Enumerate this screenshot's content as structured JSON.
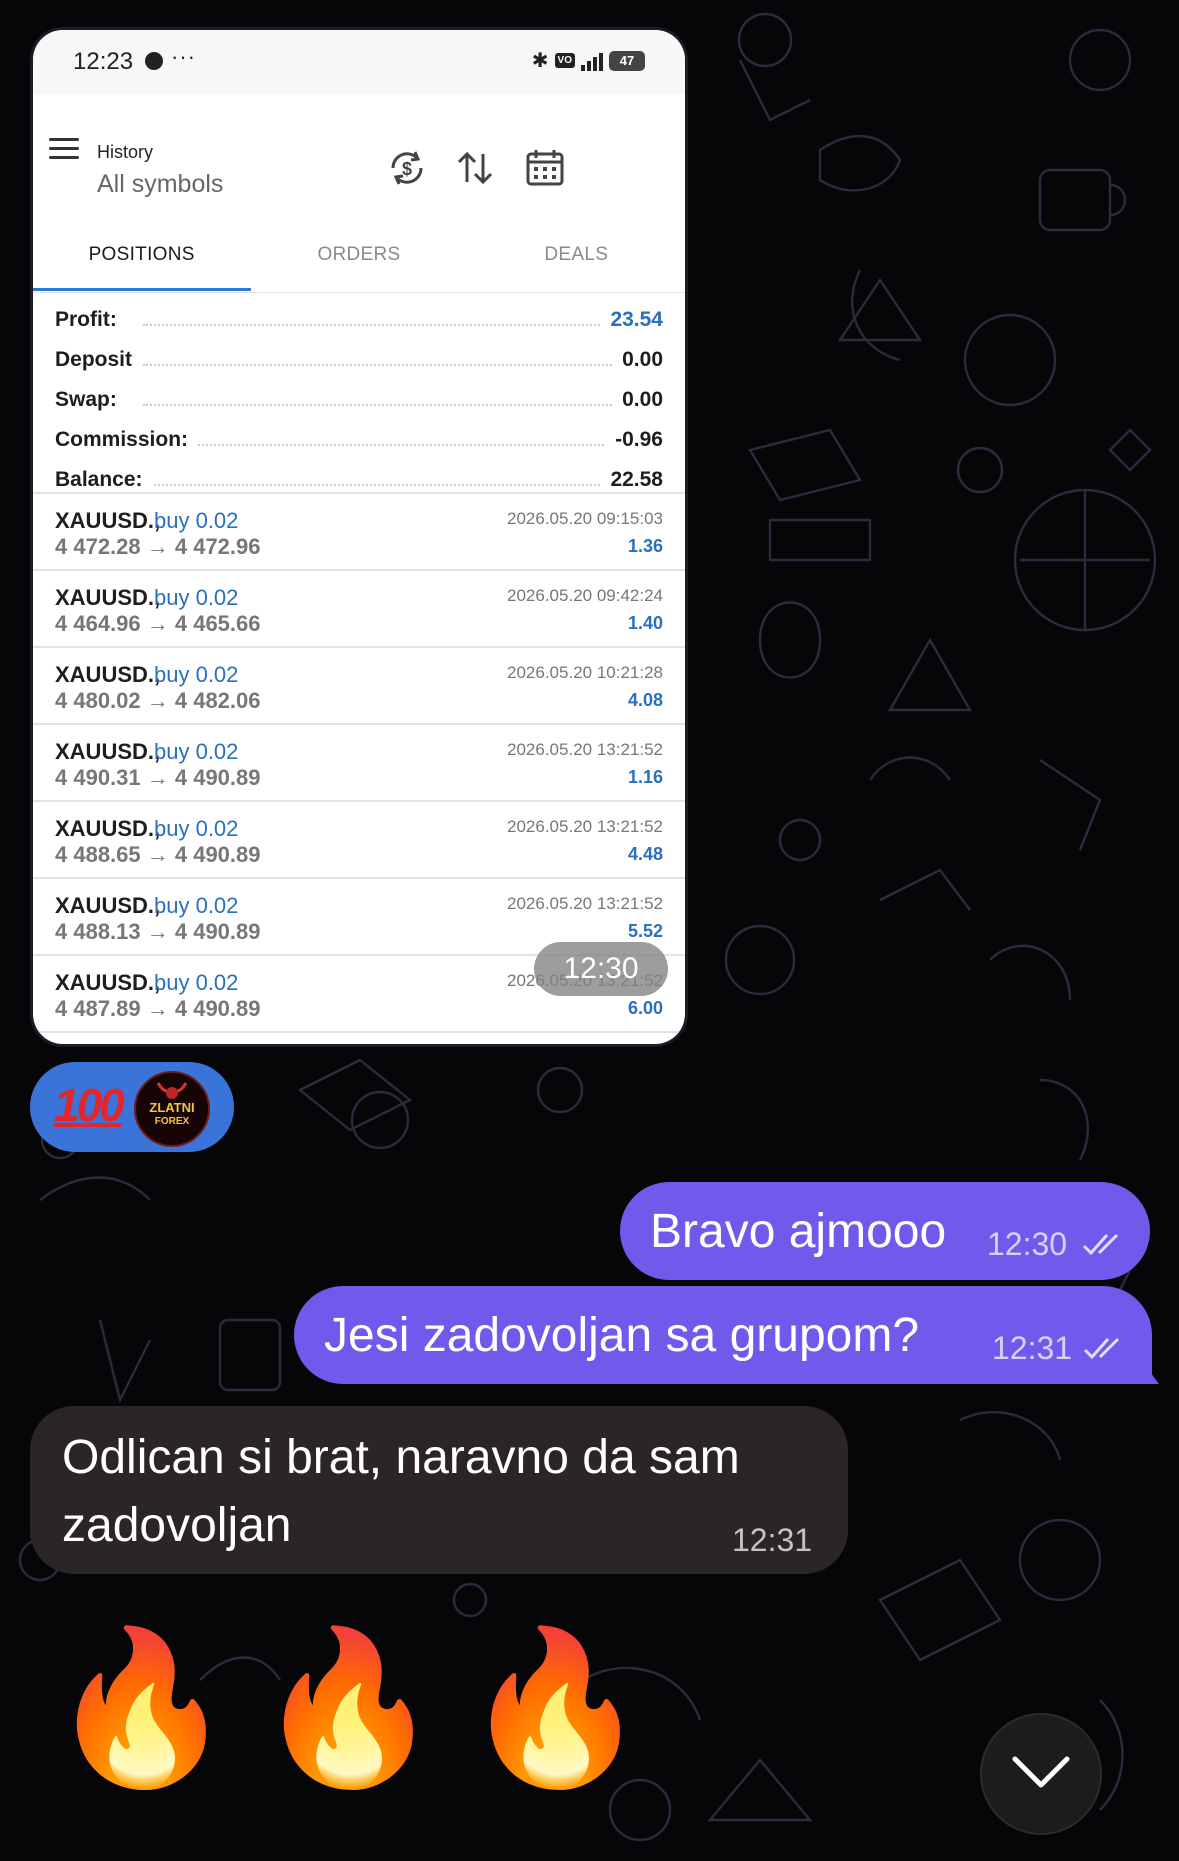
{
  "status_bar": {
    "time": "12:23",
    "more": "···",
    "network": "4G+",
    "battery": "47"
  },
  "history": {
    "title": "History",
    "subtitle": "All symbols"
  },
  "tabs": [
    "POSITIONS",
    "ORDERS",
    "DEALS"
  ],
  "summary": [
    {
      "label": "Profit:",
      "value": "23.54",
      "highlight": true
    },
    {
      "label": "Deposit",
      "value": "0.00",
      "highlight": false
    },
    {
      "label": "Swap:",
      "value": "0.00",
      "highlight": false
    },
    {
      "label": "Commission:",
      "value": "-0.96",
      "highlight": false
    },
    {
      "label": "Balance:",
      "value": "22.58",
      "highlight": false
    }
  ],
  "positions": [
    {
      "symbol": "XAUUSD.,",
      "side": "buy 0.02",
      "prices": "4 472.28 → 4 472.96",
      "time": "2026.05.20 09:15:03",
      "profit": "1.36"
    },
    {
      "symbol": "XAUUSD.,",
      "side": "buy 0.02",
      "prices": "4 464.96 → 4 465.66",
      "time": "2026.05.20 09:42:24",
      "profit": "1.40"
    },
    {
      "symbol": "XAUUSD.,",
      "side": "buy 0.02",
      "prices": "4 480.02 → 4 482.06",
      "time": "2026.05.20 10:21:28",
      "profit": "4.08"
    },
    {
      "symbol": "XAUUSD.,",
      "side": "buy 0.02",
      "prices": "4 490.31 → 4 490.89",
      "time": "2026.05.20 13:21:52",
      "profit": "1.16"
    },
    {
      "symbol": "XAUUSD.,",
      "side": "buy 0.02",
      "prices": "4 488.65 → 4 490.89",
      "time": "2026.05.20 13:21:52",
      "profit": "4.48"
    },
    {
      "symbol": "XAUUSD.,",
      "side": "buy 0.02",
      "prices": "4 488.13 → 4 490.89",
      "time": "2026.05.20 13:21:52",
      "profit": "5.52"
    },
    {
      "symbol": "XAUUSD.,",
      "side": "buy 0.02",
      "prices": "4 487.89 → 4 490.89",
      "time": "2026.05.20 13:21:52",
      "profit": "6.00"
    }
  ],
  "screenshot_message_time": "12:30",
  "reaction": {
    "emoji": "100",
    "avatar_line1": "ZLATNI",
    "avatar_line2": "FOREX"
  },
  "messages": [
    {
      "text": "Bravo ajmooo",
      "time": "12:30",
      "direction": "outgoing",
      "status": "read"
    },
    {
      "text": "Jesi zadovoljan sa grupom?",
      "time": "12:31",
      "direction": "outgoing",
      "status": "read"
    },
    {
      "text_line1": "Odlican si brat, naravno da sam",
      "text_line2": "zadovoljan",
      "time": "12:31",
      "direction": "incoming"
    }
  ],
  "fire_emojis": [
    "🔥",
    "🔥",
    "🔥"
  ],
  "icons": {
    "menu": "hamburger-icon",
    "currency_exchange": "currency-exchange-icon",
    "sort": "sort-arrows-icon",
    "calendar": "calendar-icon",
    "scroll_down": "chevron-down-icon"
  },
  "colors": {
    "outgoing_bubble": "#7358ec",
    "incoming_bubble": "#2b2528",
    "profit_blue": "#2a6fc0",
    "reaction_blue": "#3a74d8"
  }
}
